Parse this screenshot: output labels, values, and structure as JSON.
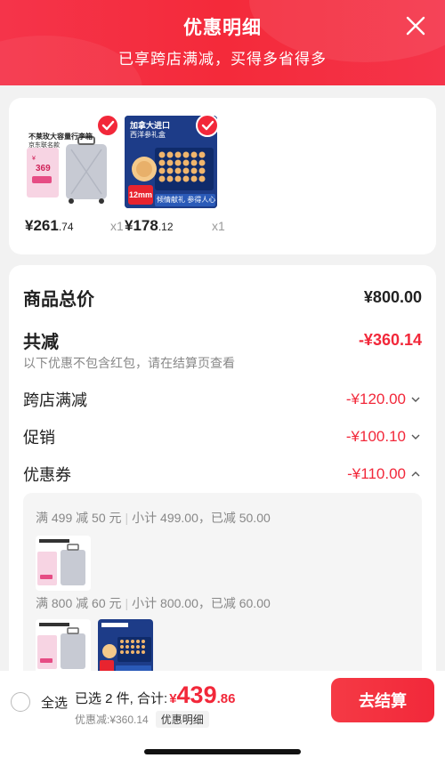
{
  "header": {
    "title": "优惠明细",
    "subtitle": "已享跨店满减，买得多省得多"
  },
  "products": [
    {
      "price_int": "¥261",
      "price_dec": ".74",
      "qty": "x1",
      "image_text": "不莱玫大容量行李箱",
      "image_sub": "京东联名款",
      "image_price": "369"
    },
    {
      "price_int": "¥178",
      "price_dec": ".12",
      "qty": "x1",
      "image_text": "加拿大进口",
      "image_sub": "西洋参礼盒",
      "image_badge": "12mm",
      "image_footer": "倾情献礼 参得人心"
    }
  ],
  "detail": {
    "total_label": "商品总价",
    "total_value": "¥800.00",
    "discount_label": "共减",
    "discount_value": "-¥360.14",
    "note": "以下优惠不包含红包，请在结算页查看",
    "items": [
      {
        "label": "跨店满减",
        "value": "-¥120.00"
      },
      {
        "label": "促销",
        "value": "-¥100.10"
      },
      {
        "label": "优惠券",
        "value": "-¥110.00"
      }
    ],
    "coupons": [
      {
        "rule": "满 499 减 50 元",
        "info": "小计 499.00，已减 50.00"
      },
      {
        "rule": "满 800 减 60 元",
        "info": "小计 800.00，已减 60.00"
      }
    ]
  },
  "bottom": {
    "select_all": "全选",
    "selected": "已选 2 件, 合计:",
    "total_yen": "¥",
    "total_int": "439",
    "total_dec": ".86",
    "discount_text": "优惠减:¥360.14",
    "detail_link": "优惠明细",
    "checkout": "去结算"
  },
  "colors": {
    "accent": "#f2283a",
    "header": "#f42a3a"
  }
}
